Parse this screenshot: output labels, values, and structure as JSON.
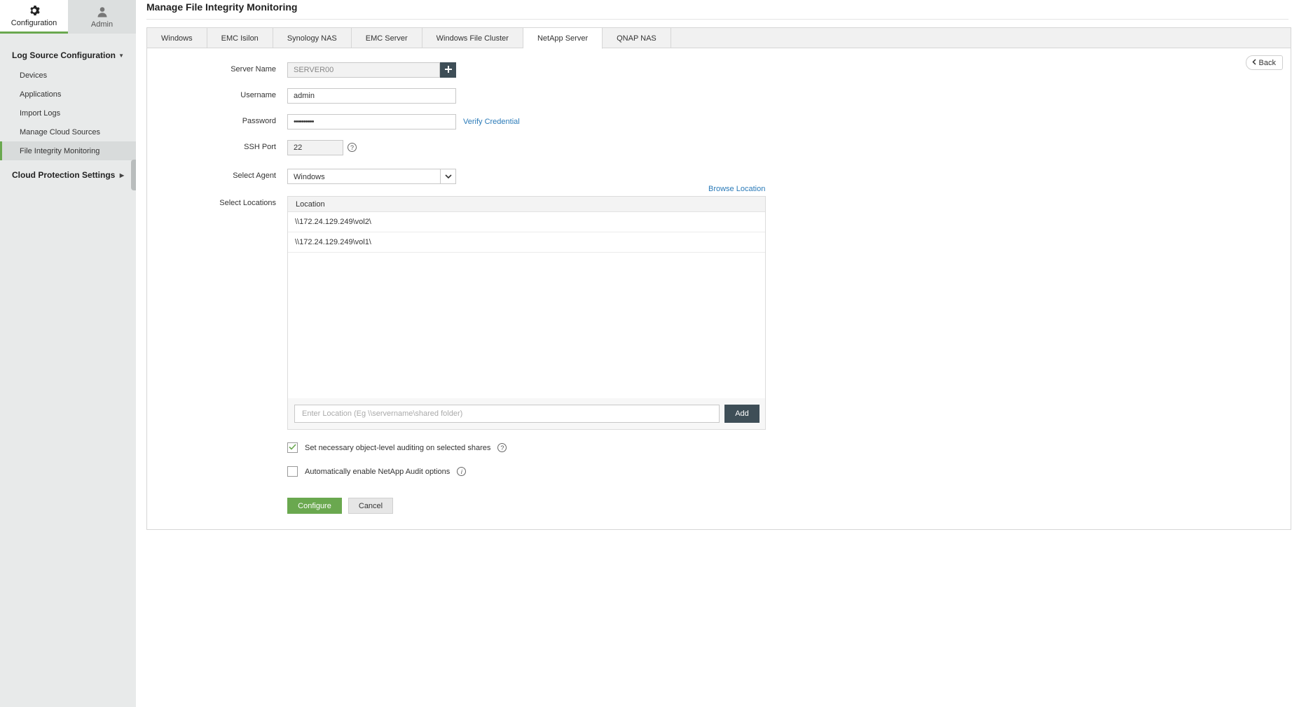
{
  "topnav": {
    "configuration_label": "Configuration",
    "admin_label": "Admin"
  },
  "sidebar": {
    "section1_label": "Log Source Configuration",
    "items": [
      {
        "label": "Devices"
      },
      {
        "label": "Applications"
      },
      {
        "label": "Import Logs"
      },
      {
        "label": "Manage Cloud Sources"
      },
      {
        "label": "File Integrity Monitoring"
      }
    ],
    "section2_label": "Cloud Protection Settings"
  },
  "page": {
    "title": "Manage File Integrity Monitoring"
  },
  "tabs": [
    {
      "label": "Windows"
    },
    {
      "label": "EMC Isilon"
    },
    {
      "label": "Synology NAS"
    },
    {
      "label": "EMC Server"
    },
    {
      "label": "Windows File Cluster"
    },
    {
      "label": "NetApp Server"
    },
    {
      "label": "QNAP NAS"
    }
  ],
  "active_tab": "NetApp Server",
  "form": {
    "back_label": "Back",
    "server_name_label": "Server Name",
    "server_name_value": "SERVER00",
    "username_label": "Username",
    "username_value": "admin",
    "password_label": "Password",
    "password_value": "••••••••••",
    "verify_credential_label": "Verify Credential",
    "ssh_port_label": "SSH Port",
    "ssh_port_value": "22",
    "select_agent_label": "Select Agent",
    "select_agent_value": "Windows",
    "select_locations_label": "Select Locations",
    "browse_location_label": "Browse Location",
    "location_column_header": "Location",
    "locations": [
      {
        "path": "\\\\172.24.129.249\\vol2\\"
      },
      {
        "path": "\\\\172.24.129.249\\vol1\\"
      }
    ],
    "location_input_placeholder": "Enter Location (Eg \\\\servername\\shared folder)",
    "add_label": "Add",
    "auditing_checkbox_label": "Set necessary object-level auditing on selected shares",
    "auditing_checked": true,
    "netapp_audit_checkbox_label": "Automatically enable NetApp Audit options",
    "netapp_audit_checked": false,
    "configure_label": "Configure",
    "cancel_label": "Cancel"
  },
  "colors": {
    "accent_green": "#6aa84f",
    "dark_button": "#3e4e57",
    "link_blue": "#2a7ab8"
  }
}
